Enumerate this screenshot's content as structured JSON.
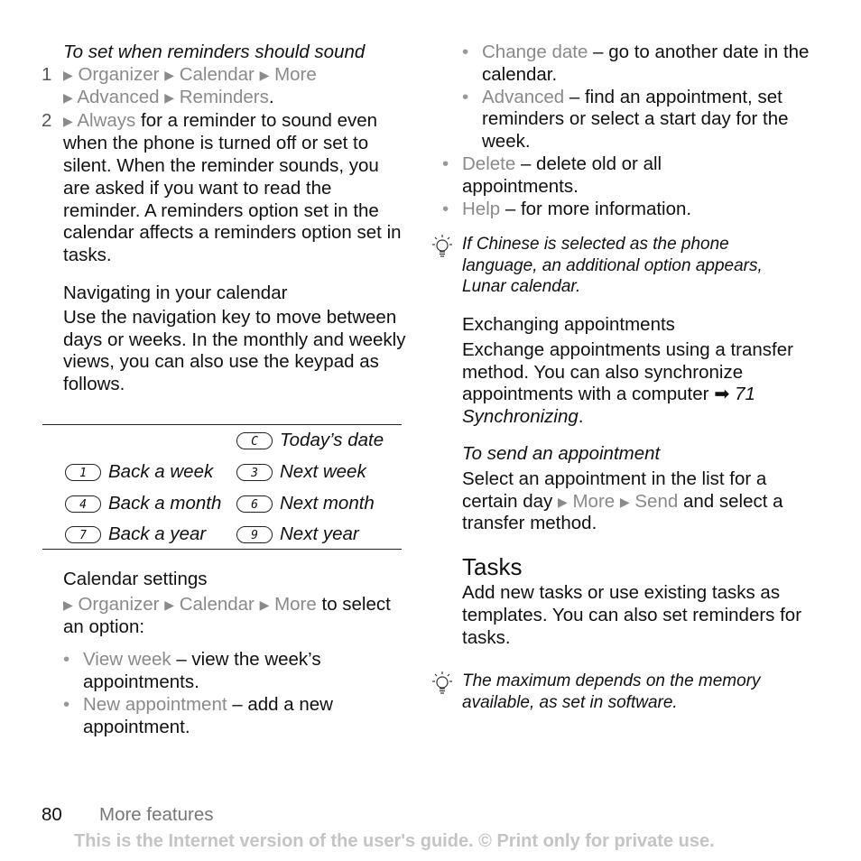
{
  "left": {
    "reminder_heading": "To set when reminders should sound",
    "step1": {
      "number": "1",
      "path": [
        "Organizer",
        "Calendar",
        "More",
        "Advanced",
        "Reminders"
      ],
      "end": "."
    },
    "step2": {
      "number": "2",
      "path_item": "Always",
      "text": " for a reminder to sound even when the phone is turned off or set to silent. When the reminder sounds, you are asked if you want to read the reminder. A reminders option set in the calendar affects a reminders option set in tasks."
    },
    "nav_heading": "Navigating in your calendar",
    "nav_text": "Use the navigation key to move between days or weeks. In the monthly and weekly views, you can also use the keypad as follows.",
    "keys": [
      {
        "key": "C",
        "label": "Today’s date"
      },
      {
        "key": "1",
        "label": "Back a week"
      },
      {
        "key": "3",
        "label": "Next week"
      },
      {
        "key": "4",
        "label": "Back a month"
      },
      {
        "key": "6",
        "label": "Next month"
      },
      {
        "key": "7",
        "label": "Back a year"
      },
      {
        "key": "9",
        "label": "Next year"
      }
    ],
    "settings_heading": "Calendar settings",
    "settings_path": [
      "Organizer",
      "Calendar",
      "More"
    ],
    "settings_after": " to select an option:",
    "bullets": [
      {
        "term": "View week",
        "desc": " – view the week’s appointments."
      },
      {
        "term": "New appointment",
        "desc": " – add a new appointment."
      }
    ]
  },
  "right": {
    "bullets_a": [
      {
        "term": "Change date",
        "desc": " – go to another date in the calendar."
      },
      {
        "term": "Advanced",
        "desc": " – find an appointment, set reminders or select a start day for the week."
      }
    ],
    "bullets_b": [
      {
        "term": "Delete",
        "desc": " – delete old or all appointments."
      },
      {
        "term": "Help",
        "desc": " – for more information."
      }
    ],
    "tip1": "If Chinese is selected as the phone language, an additional option appears, Lunar calendar.",
    "exchange_heading": "Exchanging appointments",
    "exchange_text": "Exchange appointments using a transfer method. You can also synchronize appointments with a computer ",
    "exchange_ref": "71 Synchronizing",
    "send_heading": "To send an appointment",
    "send_text_a": "Select an appointment in the list for a certain day ",
    "send_path": [
      "More",
      "Send"
    ],
    "send_text_b": " and select a transfer method.",
    "tasks_heading": "Tasks",
    "tasks_text": "Add new tasks or use existing tasks as templates. You can also set reminders for tasks.",
    "tip2": "The maximum depends on the memory available, as set in software."
  },
  "footer": {
    "page_number": "80",
    "section": "More features",
    "notice": "This is the Internet version of the user's guide. © Print only for private use."
  }
}
